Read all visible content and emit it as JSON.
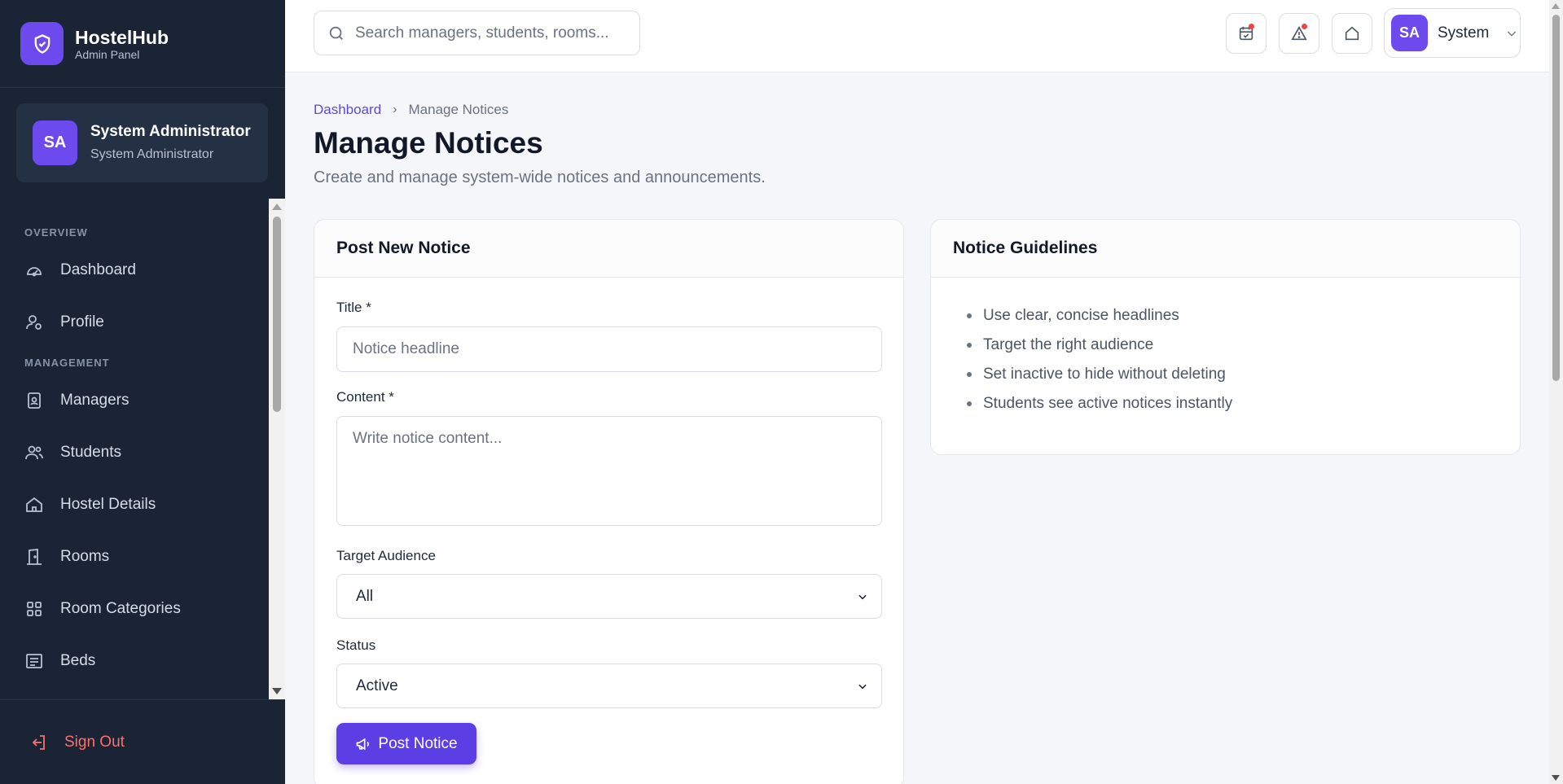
{
  "brand": {
    "name": "HostelHub",
    "subtitle": "Admin Panel"
  },
  "user": {
    "initials": "SA",
    "name": "System Administrator",
    "role": "System Administrator"
  },
  "nav": {
    "overview_label": "OVERVIEW",
    "management_label": "MANAGEMENT",
    "items": [
      {
        "label": "Dashboard",
        "icon": "gauge-icon"
      },
      {
        "label": "Profile",
        "icon": "user-gear-icon"
      },
      {
        "label": "Managers",
        "icon": "id-badge-icon"
      },
      {
        "label": "Students",
        "icon": "users-icon"
      },
      {
        "label": "Hostel Details",
        "icon": "home-icon"
      },
      {
        "label": "Rooms",
        "icon": "door-icon"
      },
      {
        "label": "Room Categories",
        "icon": "grid-icon"
      },
      {
        "label": "Beds",
        "icon": "bed-list-icon"
      }
    ],
    "signout": "Sign Out"
  },
  "topbar": {
    "search_placeholder": "Search managers, students, rooms...",
    "user_initials": "SA",
    "user_label": "System"
  },
  "page": {
    "breadcrumb_home": "Dashboard",
    "breadcrumb_current": "Manage Notices",
    "title": "Manage Notices",
    "subtitle": "Create and manage system-wide notices and announcements."
  },
  "form": {
    "heading": "Post New Notice",
    "title_label": "Title *",
    "title_placeholder": "Notice headline",
    "content_label": "Content *",
    "content_placeholder": "Write notice content...",
    "audience_label": "Target Audience",
    "audience_value": "All",
    "status_label": "Status",
    "status_value": "Active",
    "submit_label": "Post Notice"
  },
  "guidelines": {
    "heading": "Notice Guidelines",
    "items": [
      "Use clear, concise headlines",
      "Target the right audience",
      "Set inactive to hide without deleting",
      "Students see active notices instantly"
    ]
  },
  "colors": {
    "accent": "#5b3fe4",
    "sidebar": "#1b2434",
    "danger": "#f87171"
  }
}
